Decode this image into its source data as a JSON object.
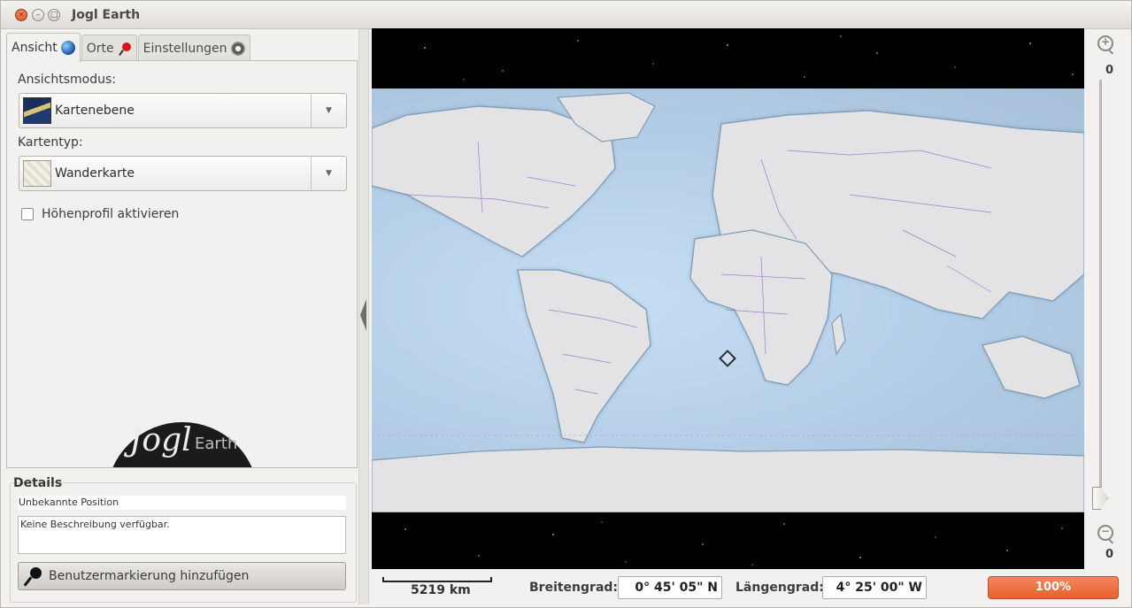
{
  "window": {
    "title": "Jogl Earth"
  },
  "tabs": [
    {
      "label": "Ansicht",
      "icon": "globe-icon",
      "active": true
    },
    {
      "label": "Orte",
      "icon": "pin-icon",
      "active": false
    },
    {
      "label": "Einstellungen",
      "icon": "gear-icon",
      "active": false
    }
  ],
  "view": {
    "mode_label": "Ansichtsmodus:",
    "mode_value": "Kartenebene",
    "maptype_label": "Kartentyp:",
    "maptype_value": "Wanderkarte",
    "elevation_label": "Höhenprofil aktivieren",
    "elevation_checked": false
  },
  "logo": {
    "word1": "Jogl",
    "word2": "Earth"
  },
  "details": {
    "header": "Details",
    "position": "Unbekannte Position",
    "description": "Keine Beschreibung verfügbar.",
    "add_button": "Benutzermarkierung hinzufügen"
  },
  "zoom": {
    "top_value": "0",
    "bottom_value": "0"
  },
  "statusbar": {
    "scale": "5219 km",
    "lat_label": "Breitengrad:",
    "lat_value": "0° 45' 05\" N",
    "lon_label": "Längengrad:",
    "lon_value": "4° 25' 00\" W",
    "progress": "100%"
  },
  "colors": {
    "progress": "#e8602e",
    "ocean": "#b8d1ea",
    "land": "#e3e3e6",
    "borders": "#8a5ac0"
  }
}
